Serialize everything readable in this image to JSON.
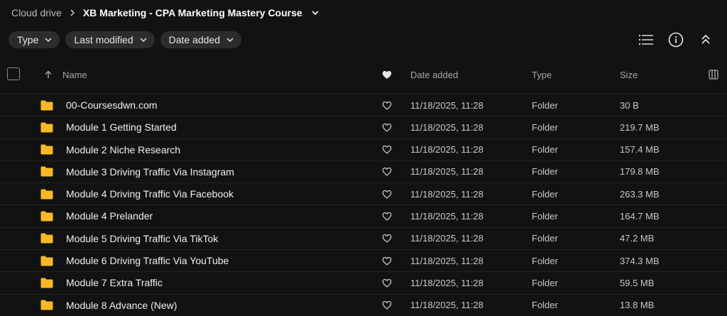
{
  "breadcrumb": {
    "root": "Cloud drive",
    "current": "XB Marketing - CPA Marketing Mastery Course"
  },
  "filters": [
    {
      "label": "Type"
    },
    {
      "label": "Last modified"
    },
    {
      "label": "Date added"
    }
  ],
  "columns": {
    "name": "Name",
    "date_added": "Date added",
    "type": "Type",
    "size": "Size"
  },
  "rows": [
    {
      "name": "00-Coursesdwn.com",
      "date": "11/18/2025, 11:28",
      "type": "Folder",
      "size": "30 B"
    },
    {
      "name": "Module 1 Getting Started",
      "date": "11/18/2025, 11:28",
      "type": "Folder",
      "size": "219.7 MB"
    },
    {
      "name": "Module 2 Niche Research",
      "date": "11/18/2025, 11:28",
      "type": "Folder",
      "size": "157.4 MB"
    },
    {
      "name": "Module 3 Driving Traffic Via Instagram",
      "date": "11/18/2025, 11:28",
      "type": "Folder",
      "size": "179.8 MB"
    },
    {
      "name": "Module 4 Driving Traffic Via Facebook",
      "date": "11/18/2025, 11:28",
      "type": "Folder",
      "size": "263.3 MB"
    },
    {
      "name": "Module 4 Prelander",
      "date": "11/18/2025, 11:28",
      "type": "Folder",
      "size": "164.7 MB"
    },
    {
      "name": "Module 5 Driving Traffic Via TikTok",
      "date": "11/18/2025, 11:28",
      "type": "Folder",
      "size": "47.2 MB"
    },
    {
      "name": "Module 6 Driving Traffic Via YouTube",
      "date": "11/18/2025, 11:28",
      "type": "Folder",
      "size": "374.3 MB"
    },
    {
      "name": "Module 7 Extra Traffic",
      "date": "11/18/2025, 11:28",
      "type": "Folder",
      "size": "59.5 MB"
    },
    {
      "name": "Module 8 Advance (New)",
      "date": "11/18/2025, 11:28",
      "type": "Folder",
      "size": "13.8 MB"
    }
  ],
  "colors": {
    "background": "#121212",
    "folder": "#f9b825",
    "chip": "#2c2c2c"
  },
  "icons": {
    "breadcrumb_separator": "chevron-right-icon",
    "breadcrumb_menu": "chevron-down-icon",
    "list_view": "list-view-icon",
    "info": "info-icon",
    "collapse": "collapse-up-icon",
    "sort": "arrow-up-icon",
    "favorite_header": "heart-filled-icon",
    "favorite_row": "heart-outline-icon",
    "columns": "columns-icon",
    "folder": "folder-icon"
  }
}
